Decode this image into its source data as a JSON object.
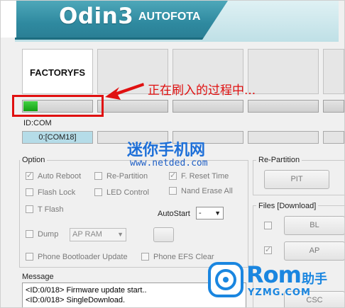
{
  "header": {
    "title": "Odin3",
    "subtitle": "AUTOFOTA"
  },
  "ports": {
    "slot_labels": [
      "FACTORYFS",
      "",
      "",
      "",
      ""
    ],
    "progress": 0.2,
    "id_com_label": "ID:COM",
    "com_ports": [
      "0:[COM18]",
      "",
      "",
      "",
      ""
    ]
  },
  "annotation": {
    "text": "正在刷入的过程中..."
  },
  "watermark": {
    "main": "迷你手机网",
    "url": "www.netded.com"
  },
  "option": {
    "title": "Option",
    "auto_reboot": "Auto Reboot",
    "re_partition": "Re-Partition",
    "f_reset_time": "F. Reset Time",
    "flash_lock": "Flash Lock",
    "led_control": "LED Control",
    "nand_erase_all": "Nand Erase All",
    "t_flash": "T Flash",
    "autostart_label": "AutoStart",
    "autostart_value": "-",
    "dump": "Dump",
    "dump_select": "AP RAM",
    "phone_bootloader_update": "Phone Bootloader Update",
    "phone_efs_clear": "Phone EFS Clear"
  },
  "repartition": {
    "title": "Re-Partition",
    "pit_button": "PIT"
  },
  "files": {
    "title": "Files [Download]",
    "bl": "BL",
    "ap": "AP",
    "csc": "CSC"
  },
  "message": {
    "title": "Message",
    "lines": [
      "<ID:0/018> Firmware update start..",
      "<ID:0/018> SingleDownload."
    ]
  },
  "logo": {
    "word": "Rom",
    "cn": "助手",
    "site": "YZMG.COM"
  }
}
